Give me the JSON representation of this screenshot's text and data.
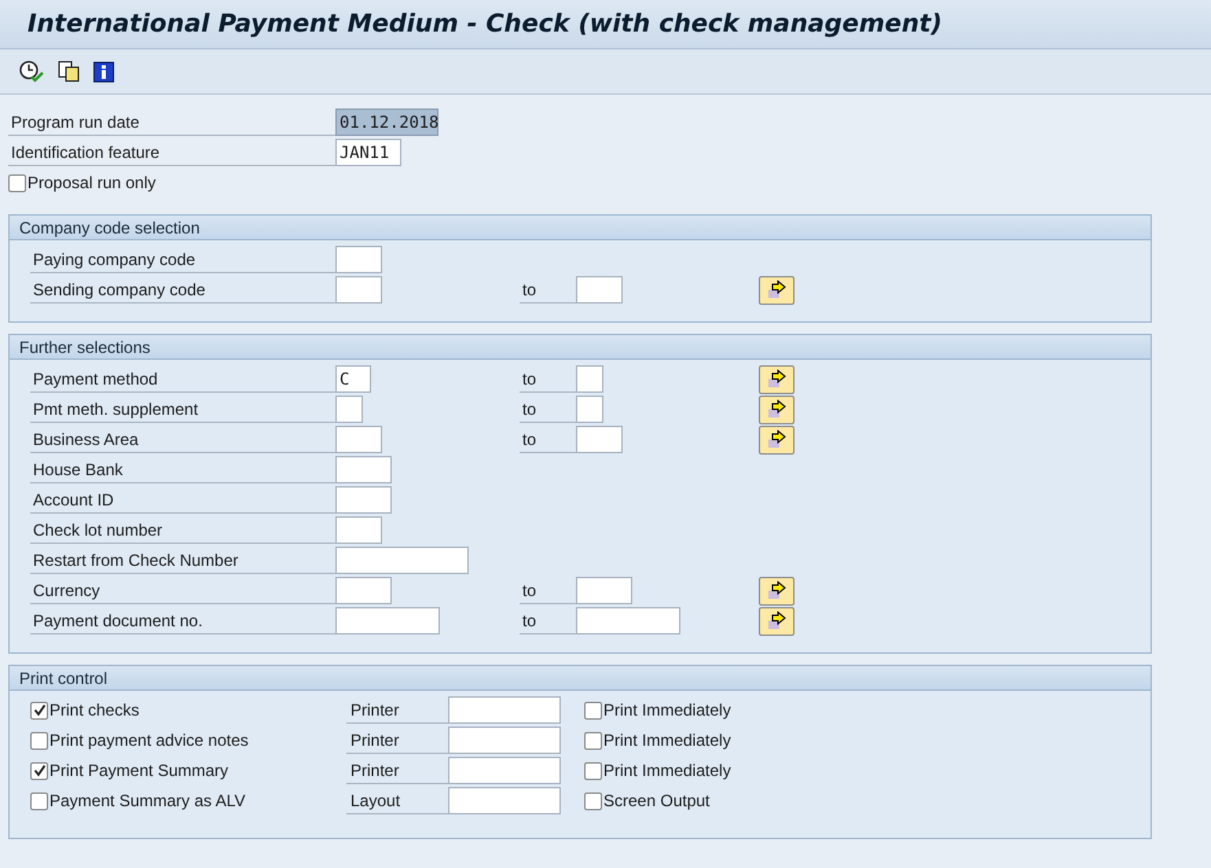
{
  "window": {
    "title": "International Payment Medium - Check (with check management)"
  },
  "top_fields": [
    {
      "label": "Program run date",
      "value": "01.12.2018",
      "highlighted": true
    },
    {
      "label": "Identification feature",
      "value": "JAN11",
      "highlighted": false
    }
  ],
  "proposal": {
    "label": "Proposal run only",
    "checked": false
  },
  "groups": [
    {
      "title": "Company code selection",
      "rows": [
        {
          "kind": "single",
          "label": "Paying company code",
          "value": ""
        },
        {
          "kind": "range",
          "label": "Sending company code",
          "value": "",
          "to_label": "to",
          "to_value": ""
        }
      ]
    },
    {
      "title": "Further selections",
      "rows": [
        {
          "kind": "range",
          "label": "Payment method",
          "value": "C",
          "to_label": "to",
          "to_value": ""
        },
        {
          "kind": "range",
          "label": "Pmt meth. supplement",
          "value": "",
          "to_label": "to",
          "to_value": ""
        },
        {
          "kind": "range",
          "label": "Business Area",
          "value": "",
          "to_label": "to",
          "to_value": ""
        },
        {
          "kind": "single",
          "label": "House Bank",
          "value": ""
        },
        {
          "kind": "single",
          "label": "Account ID",
          "value": ""
        },
        {
          "kind": "single",
          "label": "Check lot number",
          "value": ""
        },
        {
          "kind": "single",
          "label": "Restart from Check Number",
          "value": ""
        },
        {
          "kind": "range",
          "label": "Currency",
          "value": "",
          "to_label": "to",
          "to_value": ""
        },
        {
          "kind": "range",
          "label": "Payment document no.",
          "value": "",
          "to_label": "to",
          "to_value": ""
        }
      ]
    }
  ],
  "print_control": {
    "title": "Print control",
    "rows": [
      {
        "label": "Print checks",
        "checked": true,
        "field_label": "Printer",
        "field_value": "",
        "option_label": "Print Immediately",
        "option_checked": false
      },
      {
        "label": "Print payment advice notes",
        "checked": false,
        "field_label": "Printer",
        "field_value": "",
        "option_label": "Print Immediately",
        "option_checked": false
      },
      {
        "label": "Print Payment Summary",
        "checked": true,
        "field_label": "Printer",
        "field_value": "",
        "option_label": "Print Immediately",
        "option_checked": false
      },
      {
        "label": "Payment Summary as ALV",
        "checked": false,
        "field_label": "Layout",
        "field_value": "",
        "option_label": "Screen Output",
        "option_checked": false
      }
    ]
  }
}
